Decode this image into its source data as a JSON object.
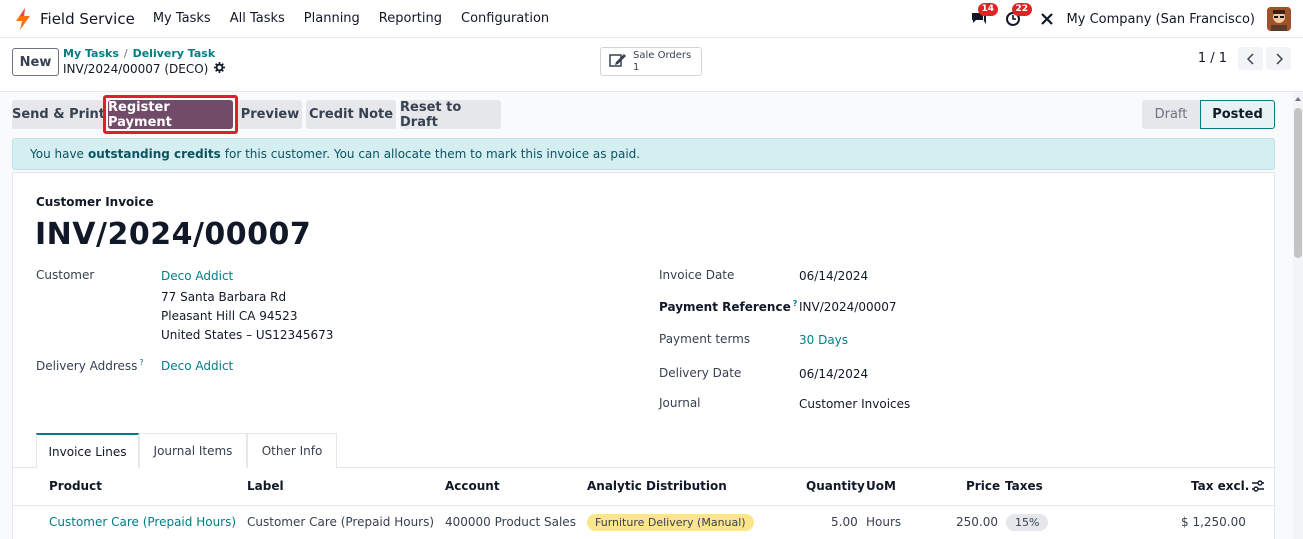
{
  "navbar": {
    "app_name": "Field Service",
    "menu": [
      "My Tasks",
      "All Tasks",
      "Planning",
      "Reporting",
      "Configuration"
    ],
    "messages_count": "14",
    "activities_count": "22",
    "company": "My Company (San Francisco)"
  },
  "control": {
    "new_label": "New",
    "breadcrumb": [
      "My Tasks",
      "Delivery Task"
    ],
    "record_title": "INV/2024/00007 (DECO)",
    "smart_button_label": "Sale Orders",
    "smart_button_count": "1",
    "pager": "1 / 1"
  },
  "actions": {
    "send_print": "Send & Print",
    "register_payment": "Register Payment",
    "preview": "Preview",
    "credit_note": "Credit Note",
    "reset_to_draft": "Reset to Draft"
  },
  "status": {
    "draft": "Draft",
    "posted": "Posted",
    "current": "Posted"
  },
  "alert": {
    "prefix": "You have",
    "bold": "outstanding credits",
    "suffix": "for this customer. You can allocate them to mark this invoice as paid."
  },
  "invoice": {
    "type_label": "Customer Invoice",
    "number": "INV/2024/00007",
    "customer_label": "Customer",
    "customer_name": "Deco Addict",
    "address_line1": "77 Santa Barbara Rd",
    "address_line2": "Pleasant Hill CA 94523",
    "address_line3": "United States – US12345673",
    "delivery_address_label": "Delivery Address",
    "delivery_address": "Deco Addict",
    "invoice_date_label": "Invoice Date",
    "invoice_date": "06/14/2024",
    "payment_ref_label": "Payment Reference",
    "payment_ref": "INV/2024/00007",
    "payment_terms_label": "Payment terms",
    "payment_terms": "30 Days",
    "delivery_date_label": "Delivery Date",
    "delivery_date": "06/14/2024",
    "journal_label": "Journal",
    "journal": "Customer Invoices"
  },
  "tabs": [
    "Invoice Lines",
    "Journal Items",
    "Other Info"
  ],
  "lines": {
    "headers": {
      "product": "Product",
      "label": "Label",
      "account": "Account",
      "analytic": "Analytic Distribution",
      "quantity": "Quantity",
      "uom": "UoM",
      "price": "Price",
      "taxes": "Taxes",
      "tax_excl": "Tax excl."
    },
    "rows": [
      {
        "product": "Customer Care (Prepaid Hours)",
        "label": "Customer Care (Prepaid Hours)",
        "account": "400000 Product Sales",
        "analytic": "Furniture Delivery (Manual)",
        "quantity": "5.00",
        "uom": "Hours",
        "price": "250.00",
        "taxes": "15%",
        "tax_excl": "$ 1,250.00"
      }
    ]
  },
  "colors": {
    "brand": "#714b67",
    "link": "#017e84",
    "highlight": "#e11d2f"
  }
}
